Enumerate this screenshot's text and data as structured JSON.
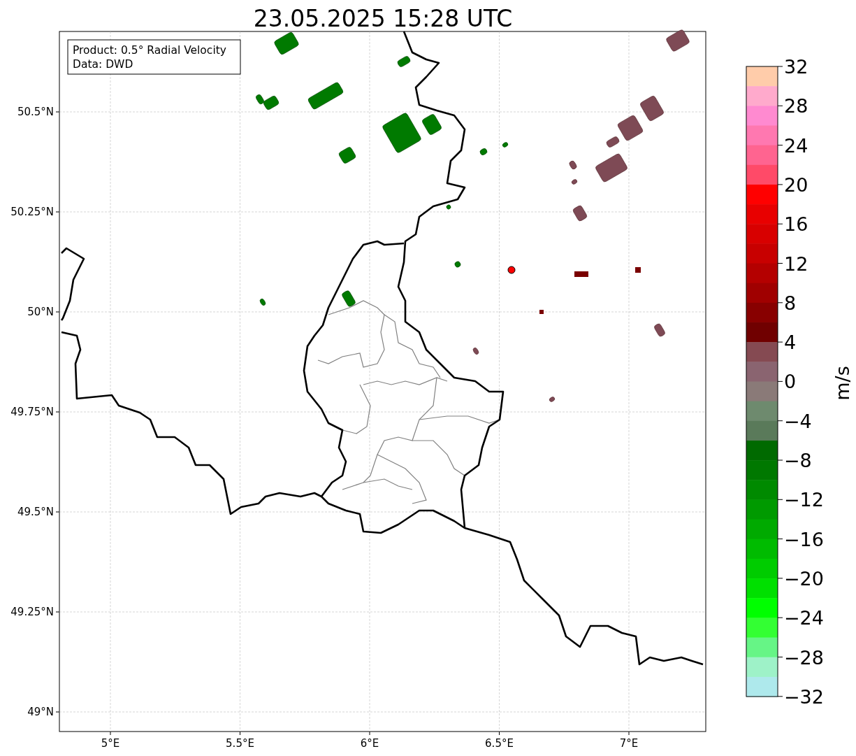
{
  "title": "23.05.2025 15:28 UTC",
  "info_box": {
    "lines": [
      "Product: 0.5° Radial Velocity",
      "Data: DWD"
    ]
  },
  "y_axis": {
    "ticks": [
      "50.5°N",
      "50.25°N",
      "50°N",
      "49.75°N",
      "49.5°N",
      "49.25°N",
      "49°N"
    ]
  },
  "x_axis": {
    "ticks": [
      "5°E",
      "5.5°E",
      "6°E",
      "6.5°E",
      "7°E"
    ]
  },
  "colorbar": {
    "label": "m/s",
    "ticks": [
      "32",
      "28",
      "24",
      "20",
      "16",
      "12",
      "8",
      "4",
      "0",
      "−4",
      "−8",
      "−12",
      "−16",
      "−20",
      "−24",
      "−28",
      "−32"
    ]
  }
}
